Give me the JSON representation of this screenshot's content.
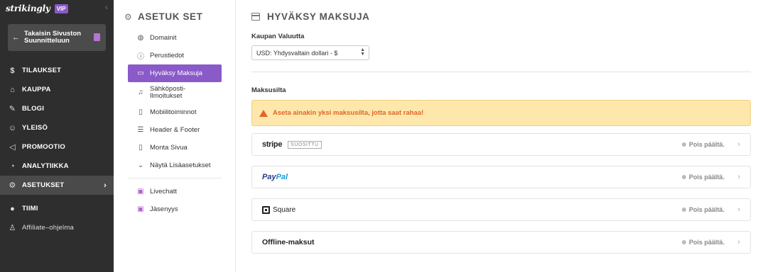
{
  "brand": {
    "name": "strikingly",
    "tier": "VIP"
  },
  "back_button": {
    "label": "Takaisin Sivuston Suunnitteluun"
  },
  "nav": {
    "items": [
      {
        "label": "TILAUKSET",
        "icon": "dollar-circle-icon"
      },
      {
        "label": "KAUPPA",
        "icon": "store-icon"
      },
      {
        "label": "BLOGI",
        "icon": "pen-icon"
      },
      {
        "label": "YLEISÖ",
        "icon": "users-icon"
      },
      {
        "label": "PROMOOTIO",
        "icon": "megaphone-icon"
      },
      {
        "label": "ANALYTIIKKA",
        "icon": "chart-icon"
      },
      {
        "label": "ASETUKSET",
        "icon": "gear-icon",
        "active": true
      }
    ],
    "extra": [
      {
        "label": "TIIMI",
        "icon": "team-icon"
      },
      {
        "label": "Affiliate–ohjelma",
        "icon": "trophy-icon"
      }
    ]
  },
  "settings": {
    "title": "ASETUK SET",
    "items": [
      {
        "label": "Domainit",
        "icon": "globe-icon"
      },
      {
        "label": "Perustiedot",
        "icon": "info-icon"
      },
      {
        "label": "Hyväksy Maksuja",
        "icon": "card-icon",
        "active": true
      },
      {
        "label": "Sähköposti-Ilmoitukset",
        "icon": "bell-icon"
      },
      {
        "label": "Mobiilitoiminnot",
        "icon": "mobile-icon"
      },
      {
        "label": "Header & Footer",
        "icon": "layout-icon"
      },
      {
        "label": "Monta Sivua",
        "icon": "pages-icon"
      },
      {
        "label": "Näytä Lisäasetukset",
        "icon": "chevron-down-icon"
      }
    ],
    "extra": [
      {
        "label": "Livechatt",
        "icon": "chat-icon"
      },
      {
        "label": "Jäsenyys",
        "icon": "member-icon"
      }
    ]
  },
  "main": {
    "title": "HYVÄKSY MAKSUJA",
    "currency_label": "Kaupan Valuutta",
    "currency_value": "USD: Yhdysvaltain dollari - $",
    "gateways_label": "Maksusilta",
    "alert": "Aseta ainakin yksi maksusilta, jotta saat rahaa!",
    "gateways": [
      {
        "name": "stripe",
        "badge": "SUOSITTU",
        "status": "Pois päältä."
      },
      {
        "name_a": "Pay",
        "name_b": "Pal",
        "status": "Pois päältä."
      },
      {
        "name": "Square",
        "status": "Pois päältä."
      },
      {
        "name": "Offline-maksut",
        "status": "Pois päältä."
      }
    ]
  },
  "colors": {
    "accent": "#8a5ac8",
    "sidebar": "#2e2e2e",
    "alert_bg": "#fde7ab",
    "alert_text": "#e0652a"
  }
}
